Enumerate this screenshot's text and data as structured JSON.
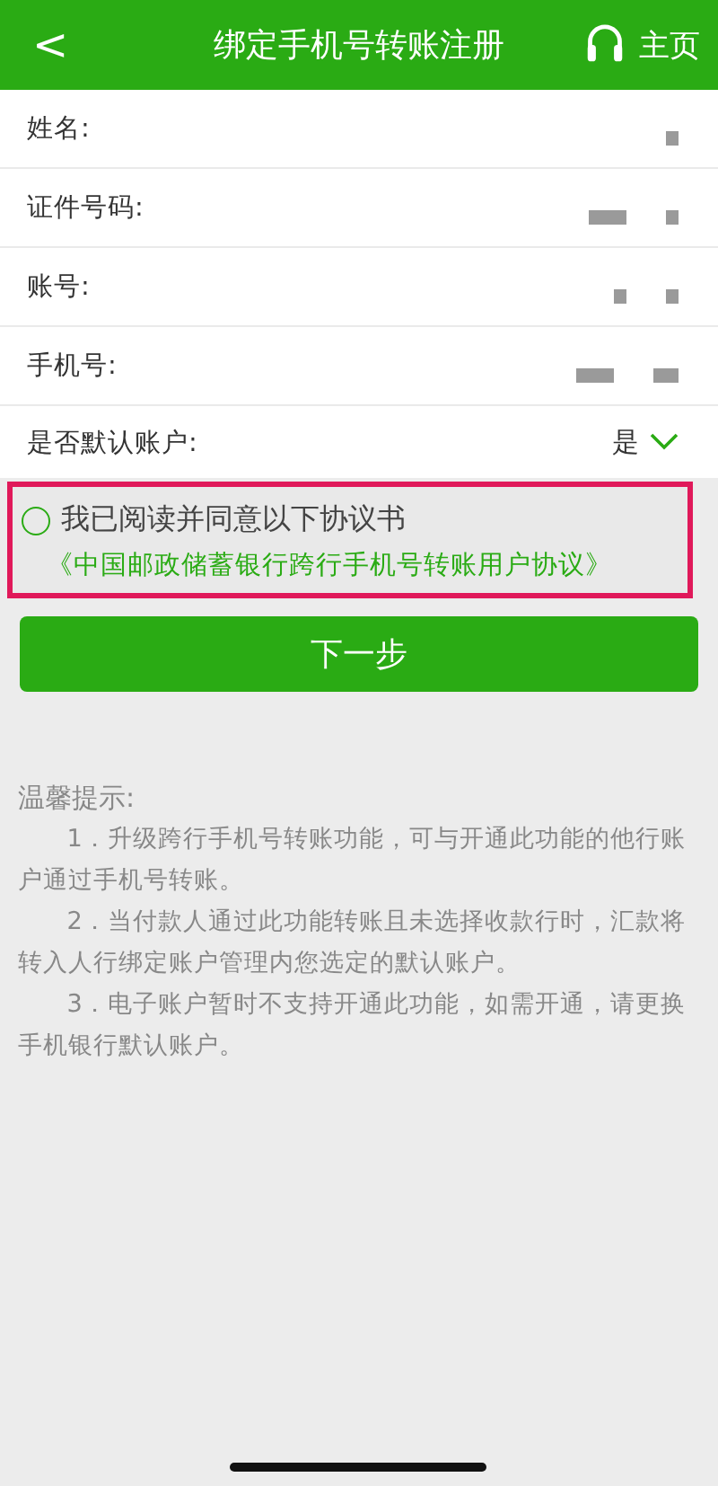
{
  "header": {
    "back": "<",
    "title": "绑定手机号转账注册",
    "home": "主页"
  },
  "fields": [
    {
      "label": "姓名:",
      "masked": true
    },
    {
      "label": "证件号码:",
      "masked": true
    },
    {
      "label": "账号:",
      "masked": true
    },
    {
      "label": "手机号:",
      "masked": true
    }
  ],
  "default_account": {
    "label": "是否默认账户:",
    "value": "是"
  },
  "agreement": {
    "checked": false,
    "text": "我已阅读并同意以下协议书",
    "link": "《中国邮政储蓄银行跨行手机号转账用户协议》",
    "highlighted": true
  },
  "next_button": "下一步",
  "tips": {
    "title": "温馨提示:",
    "items": [
      "1．升级跨行手机号转账功能，可与开通此功能的他行账户通过手机号转账。",
      "2．当付款人通过此功能转账且未选择收款行时，汇款将转入人行绑定账户管理内您选定的默认账户。",
      "3．电子账户暂时不支持开通此功能，如需开通，请更换手机银行默认账户。"
    ]
  }
}
